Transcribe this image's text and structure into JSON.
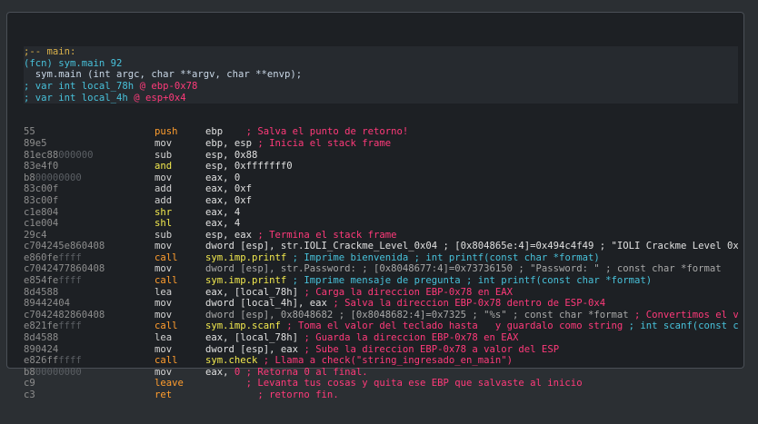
{
  "header": [
    {
      "text": ";-- main:",
      "color": "#d9b04a"
    },
    {
      "text": "(fcn) sym.main 92",
      "color": "#48c1da"
    },
    {
      "text": "  sym.main (int argc, char **argv, char **envp);",
      "color": "#c9d7e6"
    },
    {
      "parts": [
        {
          "t": "; var int local_78h ",
          "c": "#48c1da"
        },
        {
          "t": "@ ebp-0x78",
          "c": "#ff3a7a"
        }
      ]
    },
    {
      "parts": [
        {
          "t": "; var int local_4h ",
          "c": "#48c1da"
        },
        {
          "t": "@ esp+0x4",
          "c": "#ff3a7a"
        }
      ]
    }
  ],
  "rows": [
    {
      "b": "55",
      "d": "",
      "m": "push",
      "mc": "#ff9d2e",
      "ops": [
        {
          "t": "ebp",
          "c": "#e0e0e0"
        },
        {
          "t": "    ; Salva el punto de retorno!",
          "c": "#ff3a7a"
        }
      ]
    },
    {
      "b": "89e5",
      "d": "",
      "m": "mov",
      "mc": "#d3d3d3",
      "ops": [
        {
          "t": "ebp, esp",
          "c": "#e0e0e0"
        },
        {
          "t": " ; Inicia el stack frame",
          "c": "#ff3a7a"
        }
      ]
    },
    {
      "b": "81ec88",
      "d": "000000",
      "m": "sub",
      "mc": "#d3d3d3",
      "ops": [
        {
          "t": "esp, 0x88",
          "c": "#e0e0e0"
        }
      ]
    },
    {
      "b": "83e4f0",
      "d": "",
      "m": "and",
      "mc": "#f2e94e",
      "ops": [
        {
          "t": "esp, 0xfffffff0",
          "c": "#e0e0e0"
        }
      ]
    },
    {
      "b": "b8",
      "d": "00000000",
      "m": "mov",
      "mc": "#d3d3d3",
      "ops": [
        {
          "t": "eax, 0",
          "c": "#e0e0e0"
        }
      ]
    },
    {
      "b": "83c00f",
      "d": "",
      "m": "add",
      "mc": "#d3d3d3",
      "ops": [
        {
          "t": "eax, 0xf",
          "c": "#e0e0e0"
        }
      ]
    },
    {
      "b": "83c00f",
      "d": "",
      "m": "add",
      "mc": "#d3d3d3",
      "ops": [
        {
          "t": "eax, 0xf",
          "c": "#e0e0e0"
        }
      ]
    },
    {
      "b": "c1e804",
      "d": "",
      "m": "shr",
      "mc": "#f2e94e",
      "ops": [
        {
          "t": "eax, 4",
          "c": "#e0e0e0"
        }
      ]
    },
    {
      "b": "c1e004",
      "d": "",
      "m": "shl",
      "mc": "#f2e94e",
      "ops": [
        {
          "t": "eax, 4",
          "c": "#e0e0e0"
        }
      ]
    },
    {
      "b": "29c4",
      "d": "",
      "m": "sub",
      "mc": "#d3d3d3",
      "ops": [
        {
          "t": "esp, eax",
          "c": "#e0e0e0"
        },
        {
          "t": " ; Termina el stack frame",
          "c": "#ff3a7a"
        }
      ]
    },
    {
      "b": "c704245e860408",
      "d": "",
      "m": "mov",
      "mc": "#d3d3d3",
      "ops": [
        {
          "t": "dword [esp], str.IOLI_Crackme_Level_0x04 ; [0x804865e:4]=0x494c4f49 ; \"IOLI Crackme Level 0x0...",
          "c": "#e0e0e0"
        }
      ]
    },
    {
      "b": "e860fe",
      "d": "ffff",
      "m": "call",
      "mc": "#ff9d2e",
      "ops": [
        {
          "t": "sym.imp.printf",
          "c": "#f2e94e"
        },
        {
          "t": " ; Imprime bienvenida ; int printf(const char *format)",
          "c": "#48c1da"
        }
      ]
    },
    {
      "b": "c7042477860408",
      "d": "",
      "m": "mov",
      "mc": "#d3d3d3",
      "ops": [
        {
          "t": "dword [esp], str.Password: ; [0x8048677:4]=0x73736150 ; \"Password: \" ; const char *format",
          "c": "#a8a8a8"
        }
      ]
    },
    {
      "b": "e854fe",
      "d": "ffff",
      "m": "call",
      "mc": "#ff9d2e",
      "ops": [
        {
          "t": "sym.imp.printf",
          "c": "#f2e94e"
        },
        {
          "t": " ; Imprime mensaje de pregunta ; int printf(const char *format)",
          "c": "#48c1da"
        }
      ]
    },
    {
      "b": "8d4588",
      "d": "",
      "m": "lea",
      "mc": "#d3d3d3",
      "ops": [
        {
          "t": "eax, [local_78h]",
          "c": "#e0e0e0"
        },
        {
          "t": " ; Carga la direccion EBP-0x78 en EAX",
          "c": "#ff3a7a"
        }
      ]
    },
    {
      "b": "89442404",
      "d": "",
      "m": "mov",
      "mc": "#d3d3d3",
      "ops": [
        {
          "t": "dword [local_4h], eax",
          "c": "#e0e0e0"
        },
        {
          "t": " ; Salva la direccion EBP-0x78 dentro de ESP-0x4",
          "c": "#ff3a7a"
        }
      ]
    },
    {
      "b": "c7042482860408",
      "d": "",
      "m": "mov",
      "mc": "#d3d3d3",
      "ops": [
        {
          "t": "dword [esp], 0x8048682 ; [0x8048682:4]=0x7325 ; \"%s\" ; const char *format",
          "c": "#a8a8a8"
        },
        {
          "t": " ; Convertimos el va...",
          "c": "#ff3a7a"
        }
      ]
    },
    {
      "b": "e821fe",
      "d": "ffff",
      "m": "call",
      "mc": "#ff9d2e",
      "ops": [
        {
          "t": "sym.imp.scanf",
          "c": "#f2e94e"
        },
        {
          "t": " ; Toma el valor del teclado hasta   y guardalo como string",
          "c": "#ff3a7a"
        },
        {
          "t": " ; int scanf(const ch...",
          "c": "#48c1da"
        }
      ]
    },
    {
      "b": "8d4588",
      "d": "",
      "m": "lea",
      "mc": "#d3d3d3",
      "ops": [
        {
          "t": "eax, [local_78h]",
          "c": "#e0e0e0"
        },
        {
          "t": " ; Guarda la direccion EBP-0x78 en EAX",
          "c": "#ff3a7a"
        }
      ]
    },
    {
      "b": "890424",
      "d": "",
      "m": "mov",
      "mc": "#d3d3d3",
      "ops": [
        {
          "t": "dword [esp], eax",
          "c": "#e0e0e0"
        },
        {
          "t": " ; Sube la direccion EBP-0x78 a valor del ESP",
          "c": "#ff3a7a"
        }
      ]
    },
    {
      "b": "e826ff",
      "d": "ffff",
      "m": "call",
      "mc": "#ff9d2e",
      "ops": [
        {
          "t": "sym.check",
          "c": "#f2e94e"
        },
        {
          "t": " ; Llama a check(\"string_ingresado_en_main\")",
          "c": "#ff3a7a"
        }
      ]
    },
    {
      "b": "b8",
      "d": "00000000",
      "m": "mov",
      "mc": "#d3d3d3",
      "ops": [
        {
          "t": "eax, ",
          "c": "#e0e0e0"
        },
        {
          "t": "0",
          "c": "#ff3a7a"
        },
        {
          "t": " ; Retorna 0 al final.",
          "c": "#ff3a7a"
        }
      ]
    },
    {
      "b": "c9",
      "d": "",
      "m": "leave",
      "mc": "#ff9d2e",
      "ops": [
        {
          "t": "       ; Levanta tus cosas y quita ese EBP que salvaste al inicio",
          "c": "#ff3a7a"
        }
      ]
    },
    {
      "b": "c3",
      "d": "",
      "m": "ret",
      "mc": "#ff9d2e",
      "ops": [
        {
          "t": "         ; retorno fin.",
          "c": "#ff3a7a"
        }
      ]
    }
  ]
}
